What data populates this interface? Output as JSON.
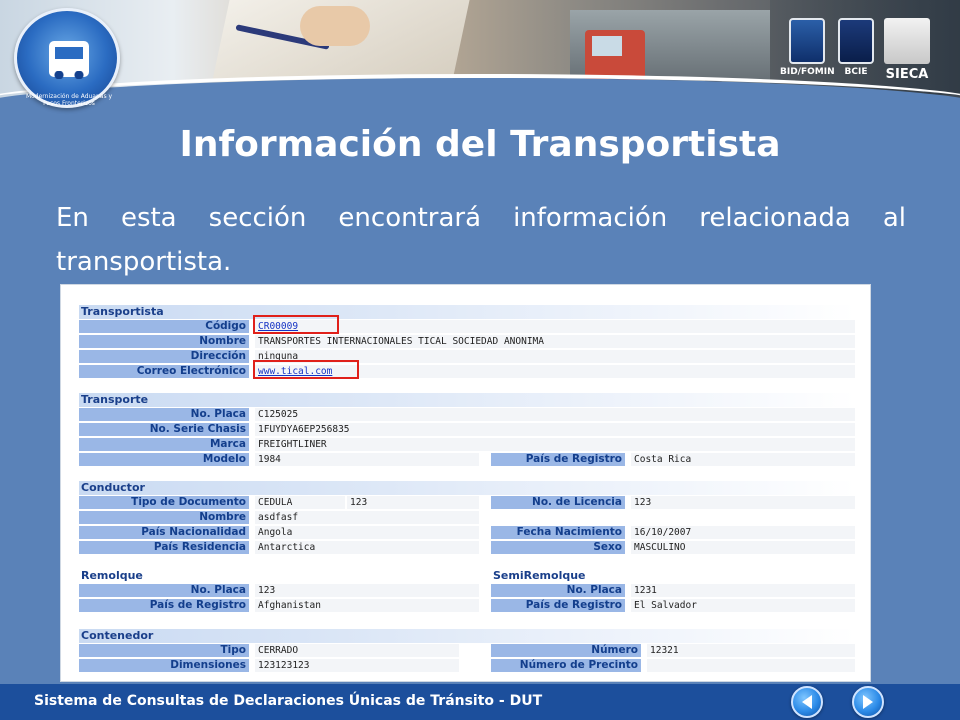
{
  "header": {
    "logo_ring_text": "Modernización de Aduanas y Pasos Fronterizos",
    "partners": [
      {
        "label": "BID/FOMIN"
      },
      {
        "label": "BCIE"
      },
      {
        "label": "SIECA"
      }
    ]
  },
  "slide": {
    "title": "Información del Transportista",
    "intro": "En esta sección encontrará información relacionada al transportista."
  },
  "form": {
    "transportista": {
      "heading": "Transportista",
      "rows": [
        {
          "label": "Código",
          "value": "CR00009"
        },
        {
          "label": "Nombre",
          "value": "TRANSPORTES INTERNACIONALES TICAL SOCIEDAD ANONIMA"
        },
        {
          "label": "Dirección",
          "value": "ninguna"
        },
        {
          "label": "Correo Electrónico",
          "value": "www.tical.com"
        }
      ]
    },
    "transporte": {
      "heading": "Transporte",
      "rows": [
        {
          "label": "No. Placa",
          "value": "C125025"
        },
        {
          "label": "No. Serie Chasis",
          "value": "1FUYDYA6EP256835"
        },
        {
          "label": "Marca",
          "value": "FREIGHTLINER"
        },
        {
          "label": "Modelo",
          "value": "1984"
        }
      ],
      "pais_registro": {
        "label": "País de Registro",
        "value": "Costa Rica"
      }
    },
    "conductor": {
      "heading": "Conductor",
      "left": [
        {
          "label": "Tipo de Documento",
          "value": "CEDULA",
          "extra": "123"
        },
        {
          "label": "Nombre",
          "value": "asdfasf"
        },
        {
          "label": "País Nacionalidad",
          "value": "Angola"
        },
        {
          "label": "País Residencia",
          "value": "Antarctica"
        }
      ],
      "right": [
        {
          "label": "No. de Licencia",
          "value": "123"
        },
        {
          "label": "Fecha Nacimiento",
          "value": "16/10/2007"
        },
        {
          "label": "Sexo",
          "value": "MASCULINO"
        }
      ]
    },
    "remolque": {
      "heading": "Remolque",
      "rows": [
        {
          "label": "No. Placa",
          "value": "123"
        },
        {
          "label": "País de Registro",
          "value": "Afghanistan"
        }
      ]
    },
    "semiremolque": {
      "heading": "SemiRemolque",
      "rows": [
        {
          "label": "No. Placa",
          "value": "1231"
        },
        {
          "label": "País de Registro",
          "value": "El Salvador"
        }
      ]
    },
    "contenedor": {
      "heading": "Contenedor",
      "left": [
        {
          "label": "Tipo",
          "value": "CERRADO"
        },
        {
          "label": "Dimensiones",
          "value": "123123123"
        }
      ],
      "right": [
        {
          "label": "Número",
          "value": "12321"
        },
        {
          "label": "Número de Precinto",
          "value": ""
        }
      ]
    }
  },
  "footer": {
    "text": "Sistema de Consultas de Declaraciones Únicas de Tránsito - DUT",
    "prev_icon": "chevron-left-icon",
    "next_icon": "chevron-right-icon"
  },
  "colors": {
    "background": "#5a82b8",
    "footer": "#1c4f9c",
    "label_bg": "#9ab7e6",
    "label_text": "#133e8c",
    "highlight": "#e0201a"
  }
}
